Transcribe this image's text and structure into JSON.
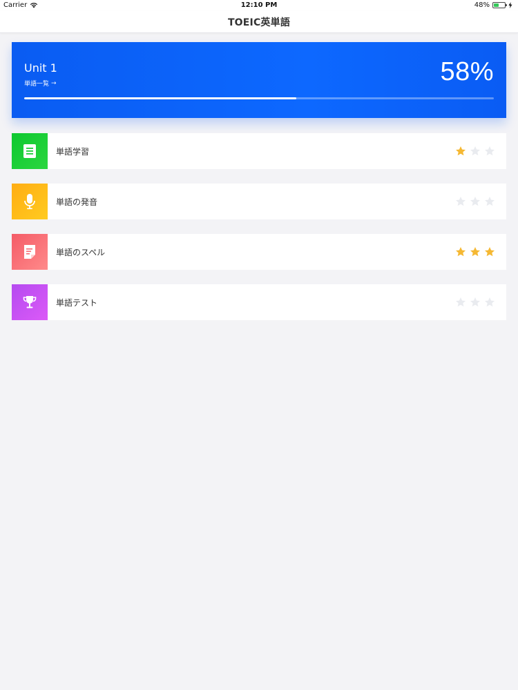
{
  "status": {
    "carrier": "Carrier",
    "time": "12:10 PM",
    "battery": "48%",
    "battery_level": 0.48
  },
  "nav": {
    "title": "TOEIC英単語"
  },
  "unit": {
    "title": "Unit 1",
    "link_label": "単語一覧",
    "link_arrow": "→",
    "percent_label": "58%",
    "progress": 0.58,
    "color": "#0a5cf2"
  },
  "menu": [
    {
      "label": "単語学習",
      "icon": "document-icon",
      "gradient": [
        "#0ec830",
        "#2bd63f"
      ],
      "stars": 1
    },
    {
      "label": "単語の発音",
      "icon": "microphone-icon",
      "gradient": [
        "#ffad14",
        "#ffcb1f"
      ],
      "stars": 0
    },
    {
      "label": "単語のスペル",
      "icon": "note-icon",
      "gradient": [
        "#f45b67",
        "#ff8a8a"
      ],
      "stars": 3
    },
    {
      "label": "単語テスト",
      "icon": "trophy-icon",
      "gradient": [
        "#b54bf0",
        "#db5af7"
      ],
      "stars": 0
    }
  ],
  "colors": {
    "star_on": "#f5b833",
    "star_off": "#e9ebef"
  }
}
